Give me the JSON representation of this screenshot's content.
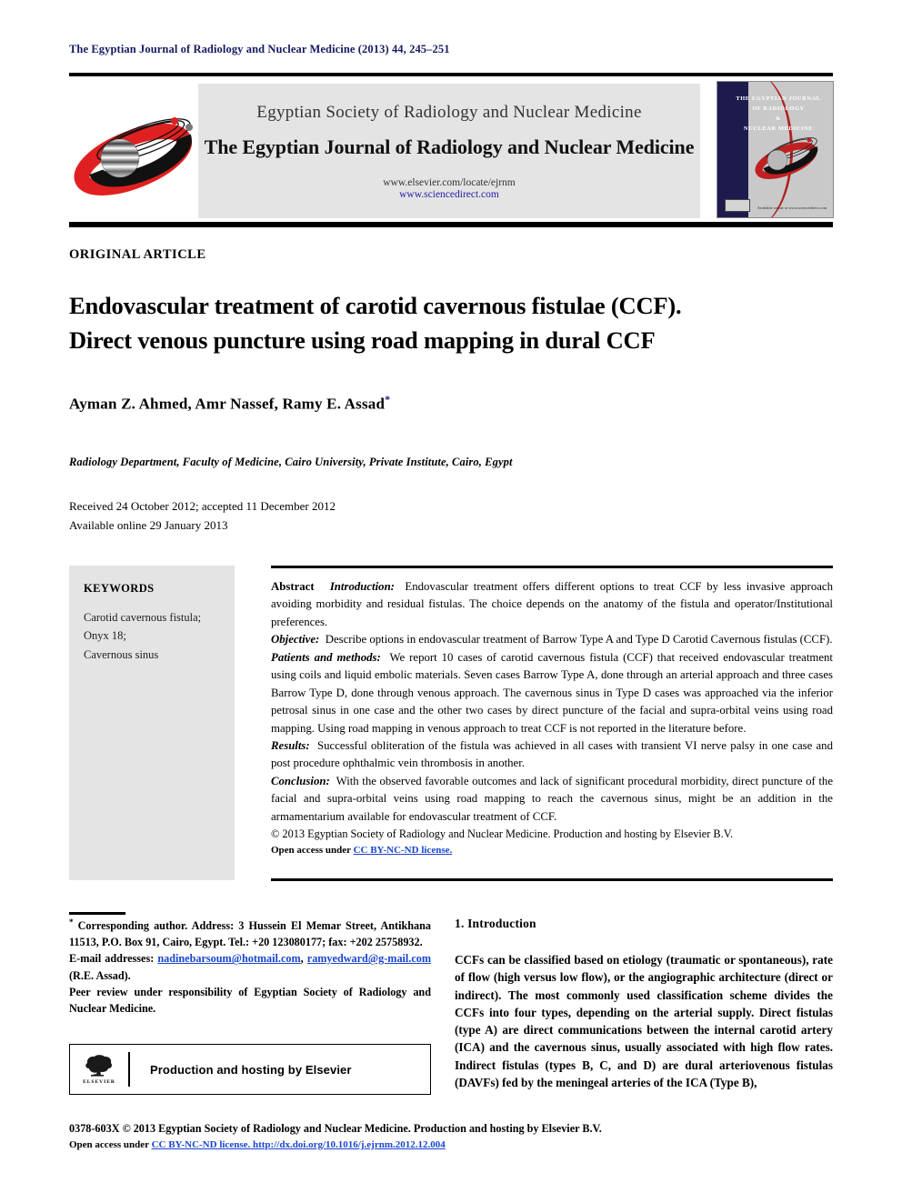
{
  "running_head": "The Egyptian Journal of Radiology and Nuclear Medicine (2013) 44, 245–251",
  "masthead": {
    "society_name": "Egyptian Society of Radiology and Nuclear Medicine",
    "journal_name": "The Egyptian Journal of Radiology and Nuclear Medicine",
    "url_elsevier": "www.elsevier.com/locate/ejrnm",
    "url_sciencedirect": "www.sciencedirect.com",
    "cover": {
      "line1": "THE EGYPTIAN JOURNAL",
      "line2": "OF RADIOLOGY",
      "line3": "&",
      "line4": "NUCLEAR MEDICINE",
      "publisher_note": "Available online at www.sciencedirect.com"
    }
  },
  "article": {
    "kicker": "ORIGINAL ARTICLE",
    "title_line1": "Endovascular treatment of carotid cavernous fistulae (CCF).",
    "title_line2": "Direct venous puncture using road mapping in dural CCF",
    "authors": "Ayman Z. Ahmed, Amr Nassef, Ramy E. Assad",
    "author_star": "*",
    "affiliation": "Radiology Department, Faculty of Medicine, Cairo University, Private Institute, Cairo, Egypt",
    "received": "Received 24 October 2012; accepted 11 December 2012",
    "available_online": "Available online 29 January 2013"
  },
  "keywords": {
    "heading": "KEYWORDS",
    "items": [
      "Carotid cavernous fistula;",
      "Onyx 18;",
      "Cavernous sinus"
    ]
  },
  "abstract": {
    "label": "Abstract",
    "introduction_label": "Introduction:",
    "introduction_text": "Endovascular treatment offers different options to treat CCF by less invasive approach avoiding morbidity and residual fistulas. The choice depends on the anatomy of the fistula and operator/Institutional preferences.",
    "objective_label": "Objective:",
    "objective_text": "Describe options in endovascular treatment of Barrow Type A and Type D Carotid Cavernous fistulas (CCF).",
    "methods_label": "Patients and methods:",
    "methods_text": "We report 10 cases of carotid cavernous fistula (CCF) that received endovascular treatment using coils and liquid embolic materials. Seven cases Barrow Type A, done through an arterial approach and three cases Barrow Type D, done through venous approach. The cavernous sinus in Type D cases was approached via the inferior petrosal sinus in one case and the other two cases by direct puncture of the facial and supra-orbital veins using road mapping. Using road mapping in venous approach to treat CCF is not reported in the literature before.",
    "results_label": "Results:",
    "results_text": "Successful obliteration of the fistula was achieved in all cases with transient VI nerve palsy in one case and post procedure ophthalmic vein thrombosis in another.",
    "conclusion_label": "Conclusion:",
    "conclusion_text": "With the observed favorable outcomes and lack of significant procedural morbidity, direct puncture of the facial and supra-orbital veins using road mapping to reach the cavernous sinus, might be an addition in the armamentarium available for endovascular treatment of CCF.",
    "copyright": "© 2013 Egyptian Society of Radiology and Nuclear Medicine. Production and hosting by Elsevier B.V.",
    "open_access_prefix": "Open access under ",
    "open_access_link": "CC BY-NC-ND license."
  },
  "footnote": {
    "star": "*",
    "corresponding": "Corresponding author. Address: 3 Hussein El Memar Street, Antikhana 11513, P.O. Box 91, Cairo, Egypt. Tel.: +20 123080177; fax: +202 25758932.",
    "email_label": "E-mail addresses:",
    "email1": "nadinebarsoum@hotmail.com",
    "email_sep": ", ",
    "email2": "ramyedward@g-mail.com",
    "email_suffix": " (R.E. Assad).",
    "peer_review": "Peer review under responsibility of Egyptian Society of Radiology and Nuclear Medicine.",
    "elsevier_box_label": "Production and hosting by Elsevier",
    "elsevier_wordmark": "ELSEVIER"
  },
  "introduction": {
    "heading": "1. Introduction",
    "paragraph": "CCFs can be classified based on etiology (traumatic or spontaneous), rate of flow (high versus low flow), or the angiographic architecture (direct or indirect). The most commonly used classification scheme divides the CCFs into four types, depending on the arterial supply. Direct fistulas (type A) are direct communications between the internal carotid artery (ICA) and the cavernous sinus, usually associated with high flow rates. Indirect fistulas (types B, C, and D) are dural arteriovenous fistulas (DAVFs) fed by the meningeal arteries of the ICA (Type B),"
  },
  "footer": {
    "line1": "0378-603X © 2013 Egyptian Society of Radiology and Nuclear Medicine. Production and hosting by Elsevier B.V.",
    "line2_prefix": "Open access under ",
    "line2_link": "CC BY-NC-ND license.",
    "line2_doi": " http://dx.doi.org/10.1016/j.ejrnm.2012.12.004"
  },
  "colors": {
    "running_head_blue": "#151b63",
    "link_blue": "#1b44d0",
    "banner_gray": "#e4e4e4",
    "logo_red": "#e02020",
    "logo_black": "#111111",
    "cover_navy": "#1d1b4e"
  }
}
